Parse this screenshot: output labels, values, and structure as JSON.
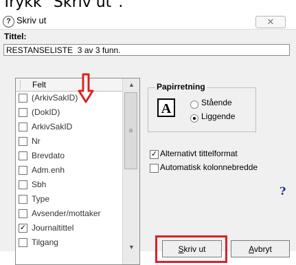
{
  "caption": {
    "text": "Trykk \"Skriv ut\"."
  },
  "window": {
    "title": "Skriv ut",
    "close_glyph": "✕"
  },
  "tittel": {
    "label": "Tittel:",
    "value": "RESTANSELISTE  3 av 3 funn."
  },
  "list": {
    "header": "Felt",
    "items": [
      {
        "label": "(ArkivSakID)",
        "checked": false
      },
      {
        "label": "(DokID)",
        "checked": false
      },
      {
        "label": "ArkivSakID",
        "checked": false
      },
      {
        "label": "Nr",
        "checked": false
      },
      {
        "label": "Brevdato",
        "checked": false
      },
      {
        "label": "Adm.enh",
        "checked": false
      },
      {
        "label": "Sbh",
        "checked": false
      },
      {
        "label": "Type",
        "checked": false
      },
      {
        "label": "Avsender/mottaker",
        "checked": false
      },
      {
        "label": "Journaltittel",
        "checked": true
      },
      {
        "label": "Tilgang",
        "checked": false
      }
    ]
  },
  "papirretning": {
    "title": "Papirretning",
    "icon_letter": "A",
    "options": [
      {
        "label": "Stående",
        "selected": false
      },
      {
        "label": "Liggende",
        "selected": true
      }
    ]
  },
  "options": {
    "alt_title": {
      "label": "Alternativt tittelformat",
      "checked": true
    },
    "auto_width": {
      "label": "Automatisk kolonnebredde",
      "checked": false
    }
  },
  "help_glyph": "?",
  "buttons": {
    "print": {
      "accel": "S",
      "rest": "kriv ut"
    },
    "cancel": {
      "accel": "A",
      "rest": "vbryt"
    }
  },
  "colors": {
    "highlight": "#dd1f25",
    "arrow": "#e02020",
    "help": "#1e2e8a"
  },
  "icons": {
    "window": "help-question-icon",
    "arrow": "down-arrow-icon"
  }
}
